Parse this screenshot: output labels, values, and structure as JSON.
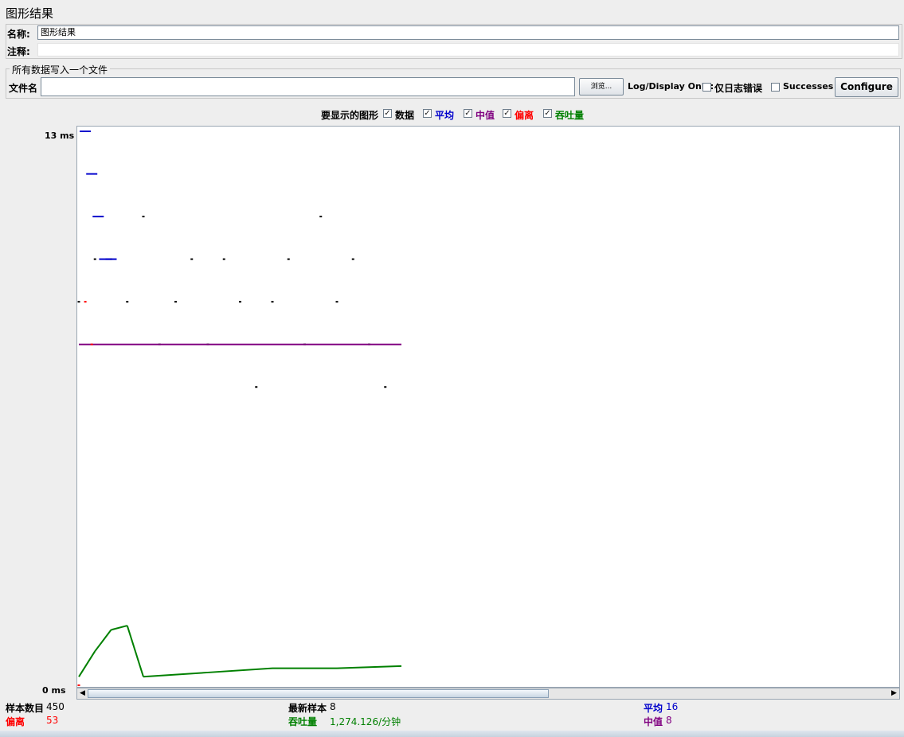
{
  "panel_title": "图形结果",
  "name_label": "名称:",
  "name_value": "图形结果",
  "comment_label": "注释:",
  "comment_value": "",
  "file_group": {
    "legend": "所有数据写入一个文件",
    "filename_label": "文件名",
    "filename_value": "",
    "browse_label": "浏览...",
    "log_display_label": "Log/Display Only:",
    "errors_only_label": "仅日志错误",
    "successes_label": "Successes",
    "configure_label": "Configure"
  },
  "graph_toggles": {
    "label": "要显示的图形",
    "items": [
      {
        "label": "数据",
        "color": "#000000",
        "checked": true
      },
      {
        "label": "平均",
        "color": "#0000cc",
        "checked": true
      },
      {
        "label": "中值",
        "color": "#800080",
        "checked": true
      },
      {
        "label": "偏离",
        "color": "#ff0000",
        "checked": true
      },
      {
        "label": "吞吐量",
        "color": "#008000",
        "checked": true
      }
    ]
  },
  "y_axis": {
    "top_label": "13  ms",
    "bottom_label": "0  ms"
  },
  "chart_data": {
    "type": "scatter",
    "ylim": [
      0,
      13
    ],
    "series": [
      {
        "name": "数据",
        "color": "#000000",
        "points": [
          [
            0,
            9
          ],
          [
            5,
            10
          ],
          [
            10,
            10
          ],
          [
            15,
            9
          ],
          [
            20,
            11
          ],
          [
            25,
            8
          ],
          [
            30,
            9
          ],
          [
            35,
            10
          ],
          [
            40,
            8
          ],
          [
            45,
            10
          ],
          [
            50,
            9
          ],
          [
            55,
            7
          ],
          [
            60,
            9
          ],
          [
            65,
            10
          ],
          [
            70,
            8
          ],
          [
            75,
            11
          ],
          [
            80,
            9
          ],
          [
            85,
            10
          ],
          [
            90,
            8
          ],
          [
            95,
            7
          ]
        ]
      },
      {
        "name": "平均",
        "color": "#0000cc",
        "points": [
          [
            2,
            13
          ],
          [
            4,
            12
          ],
          [
            6,
            11
          ],
          [
            8,
            10
          ],
          [
            10,
            10
          ]
        ]
      },
      {
        "name": "中值",
        "color": "#800080",
        "points": [
          [
            0,
            8
          ],
          [
            100,
            8
          ]
        ]
      },
      {
        "name": "偏离",
        "color": "#ff0000",
        "points": [
          [
            0,
            0
          ],
          [
            2,
            9
          ],
          [
            4,
            8
          ]
        ]
      },
      {
        "name": "吞吐量",
        "color": "#008000",
        "points": [
          [
            0,
            0.2
          ],
          [
            5,
            0.8
          ],
          [
            10,
            1.3
          ],
          [
            15,
            1.4
          ],
          [
            20,
            0.2
          ],
          [
            40,
            0.3
          ],
          [
            60,
            0.4
          ],
          [
            80,
            0.4
          ],
          [
            100,
            0.45
          ]
        ]
      }
    ]
  },
  "stats": {
    "samples_label": "样本数目",
    "samples_value": "450",
    "latest_label": "最新样本",
    "latest_value": "8",
    "average_label": "平均",
    "average_value": "16",
    "deviation_label": "偏离",
    "deviation_value": "53",
    "throughput_label": "吞吐量",
    "throughput_value": "1,274.126/分钟",
    "median_label": "中值",
    "median_value": "8"
  }
}
